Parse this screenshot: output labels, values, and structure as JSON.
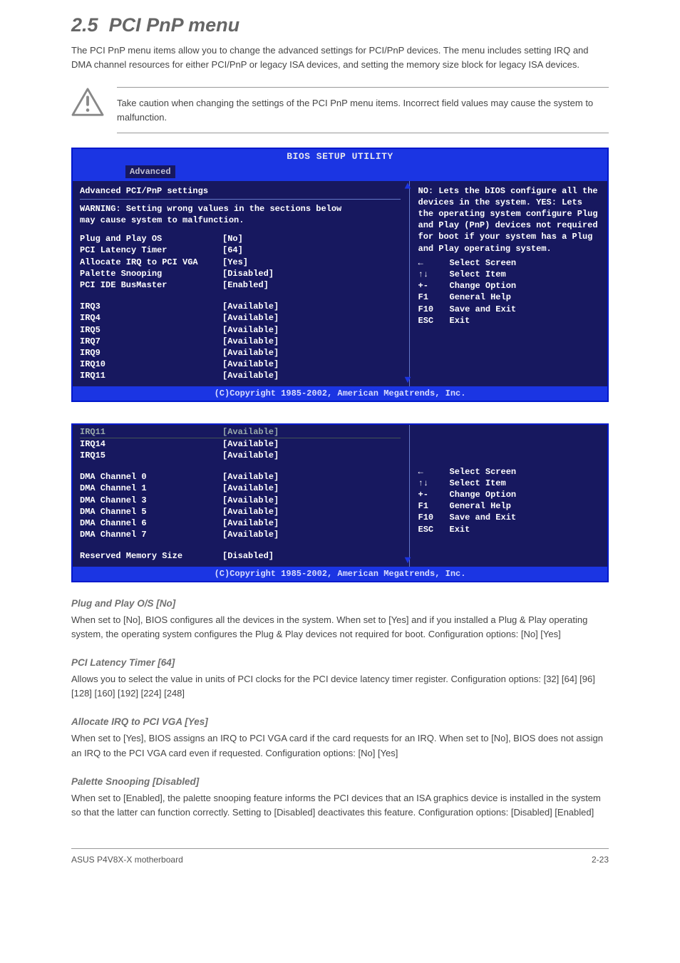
{
  "section": {
    "number": "2.5",
    "title": "PCI PnP menu",
    "intro": "The PCI PnP menu items allow you to change the advanced settings for PCI/PnP devices. The menu includes setting IRQ and DMA channel resources for either PCI/PnP or legacy ISA devices, and setting the memory size block for legacy ISA devices."
  },
  "caution": "Take caution when changing the settings of the PCI PnP menu items. Incorrect field values may cause the system to malfunction.",
  "bios1": {
    "title": "BIOS SETUP UTILITY",
    "tab": "Advanced",
    "panelTitle": "Advanced PCI/PnP settings",
    "warningLine1": "WARNING: Setting wrong values in the sections below",
    "warningLine2": "         may cause system to malfunction.",
    "settings": [
      {
        "label": "Plug and Play OS",
        "value": "[No]"
      },
      {
        "label": "PCI Latency Timer",
        "value": "[64]"
      },
      {
        "label": "Allocate IRQ to PCI VGA",
        "value": "[Yes]"
      },
      {
        "label": "Palette Snooping",
        "value": "[Disabled]"
      },
      {
        "label": "PCI IDE BusMaster",
        "value": "[Enabled]"
      }
    ],
    "irq": [
      {
        "label": "IRQ3",
        "value": "[Available]"
      },
      {
        "label": "IRQ4",
        "value": "[Available]"
      },
      {
        "label": "IRQ5",
        "value": "[Available]"
      },
      {
        "label": "IRQ7",
        "value": "[Available]"
      },
      {
        "label": "IRQ9",
        "value": "[Available]"
      },
      {
        "label": "IRQ10",
        "value": "[Available]"
      },
      {
        "label": "IRQ11",
        "value": "[Available]"
      }
    ],
    "help": "NO: Lets the bIOS configure all the devices in the system. YES: Lets the operating system configure Plug and Play (PnP) devices not required for boot if your system has a Plug and Play operating system.",
    "legend": [
      {
        "key": "←",
        "text": "Select Screen"
      },
      {
        "key": "↑↓",
        "text": "Select Item"
      },
      {
        "key": "+-",
        "text": "Change Option"
      },
      {
        "key": "F1",
        "text": "General Help"
      },
      {
        "key": "F10",
        "text": "Save and Exit"
      },
      {
        "key": "ESC",
        "text": "Exit"
      }
    ],
    "copyright": "(C)Copyright 1985-2002, American Megatrends, Inc."
  },
  "bios2": {
    "topOverflow": [
      {
        "label": "IRQ11",
        "value": "[Available]"
      },
      {
        "label": "IRQ14",
        "value": "[Available]"
      },
      {
        "label": "IRQ15",
        "value": "[Available]"
      }
    ],
    "dma": [
      {
        "label": "DMA Channel 0",
        "value": "[Available]"
      },
      {
        "label": "DMA Channel 1",
        "value": "[Available]"
      },
      {
        "label": "DMA Channel 3",
        "value": "[Available]"
      },
      {
        "label": "DMA Channel 5",
        "value": "[Available]"
      },
      {
        "label": "DMA Channel 6",
        "value": "[Available]"
      },
      {
        "label": "DMA Channel 7",
        "value": "[Available]"
      }
    ],
    "reserved": {
      "label": "Reserved Memory Size",
      "value": "[Disabled]"
    },
    "legend": [
      {
        "key": "←",
        "text": "Select Screen"
      },
      {
        "key": "↑↓",
        "text": "Select Item"
      },
      {
        "key": "+-",
        "text": "Change Option"
      },
      {
        "key": "F1",
        "text": "General Help"
      },
      {
        "key": "F10",
        "text": "Save and Exit"
      },
      {
        "key": "ESC",
        "text": "Exit"
      }
    ],
    "copyright": "(C)Copyright 1985-2002, American Megatrends, Inc."
  },
  "paras": {
    "pnp": {
      "heading": "Plug and Play O/S [No]",
      "text": "When set to [No], BIOS configures all the devices in the system. When set to [Yes] and if you installed a Plug & Play operating system, the operating system configures the Plug & Play devices not required for boot. Configuration options: [No] [Yes]"
    },
    "latency": {
      "heading": "PCI Latency Timer [64]",
      "text": "Allows you to select the value in units of PCI clocks for the PCI device latency timer register. Configuration options: [32] [64] [96] [128] [160] [192] [224] [248]"
    },
    "allocate": {
      "heading": "Allocate IRQ to PCI VGA [Yes]",
      "text": "When set to [Yes], BIOS assigns an IRQ to PCI VGA card if the card requests for an IRQ. When set to [No], BIOS does not assign an IRQ to the PCI VGA card even if requested. Configuration options: [No] [Yes]"
    },
    "palette": {
      "heading": "Palette Snooping [Disabled]",
      "text": "When set to [Enabled], the palette snooping feature informs the PCI devices that an ISA graphics device is installed in the system so that the latter can function correctly. Setting to [Disabled] deactivates this feature. Configuration options: [Disabled] [Enabled]"
    }
  },
  "footer": {
    "left": "ASUS P4V8X-X motherboard",
    "right": "2-23"
  }
}
